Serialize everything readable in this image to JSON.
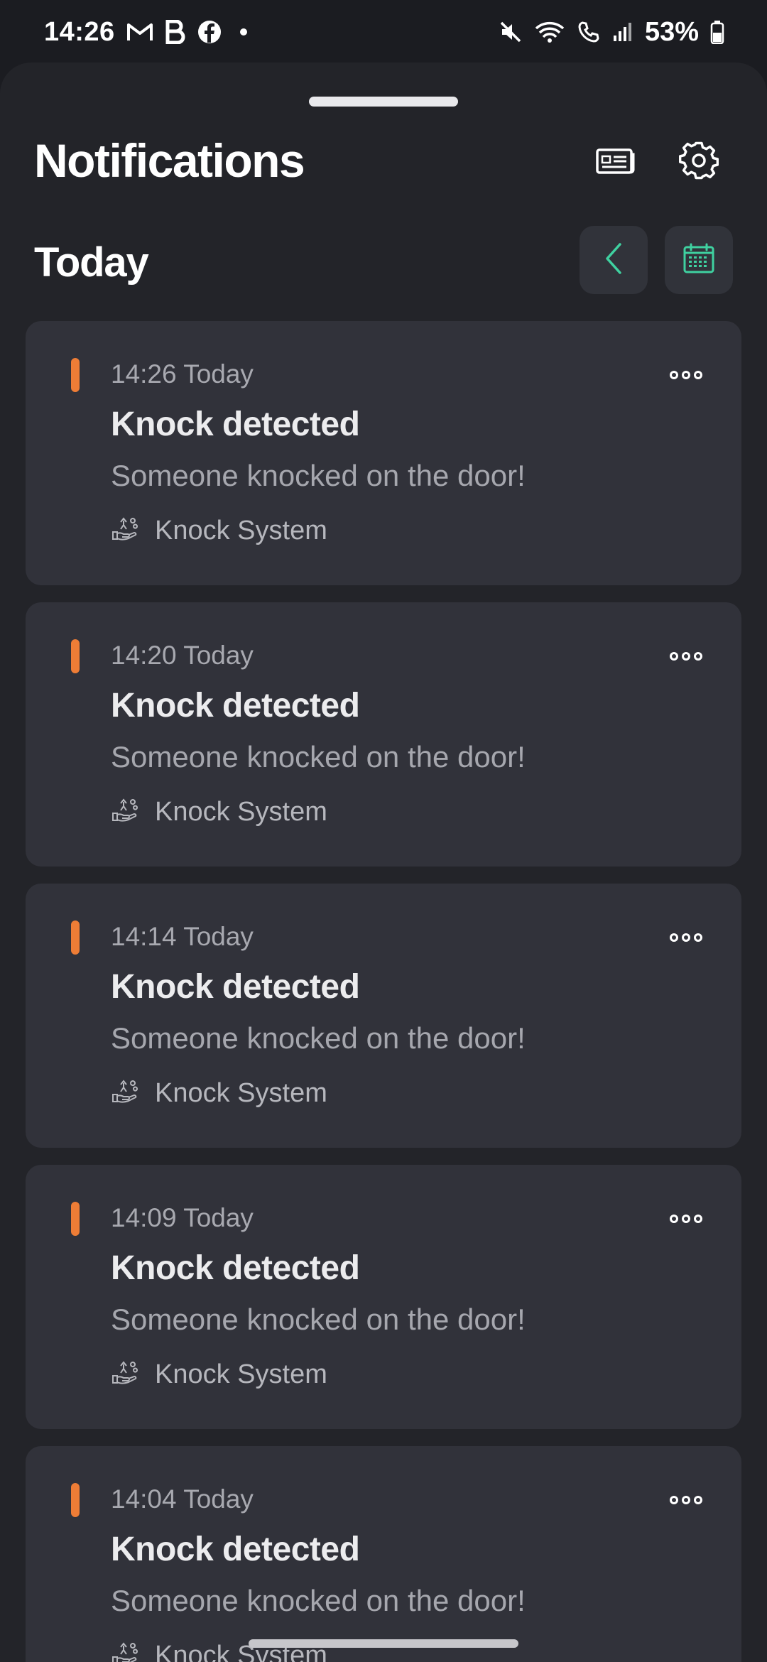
{
  "status_bar": {
    "time": "14:26",
    "app_icons": [
      "gmail-icon",
      "bold-b-icon",
      "facebook-icon"
    ],
    "system_icons": [
      "mute-icon",
      "wifi-icon",
      "wifi-call-icon",
      "signal-icon",
      "battery-icon"
    ],
    "battery_text": "53%"
  },
  "header": {
    "title": "Notifications",
    "news_icon": "news-feed-icon",
    "settings_icon": "gear-icon"
  },
  "section": {
    "title": "Today",
    "prev_icon": "chevron-left-icon",
    "calendar_icon": "calendar-icon"
  },
  "colors": {
    "accent_orange": "#ee7d36",
    "accent_green": "#3fd1a0",
    "card_bg": "#31323a",
    "sheet_bg": "#232429"
  },
  "notifications": [
    {
      "time": "14:26 Today",
      "title": "Knock detected",
      "body": "Someone knocked on the door!",
      "source": "Knock System"
    },
    {
      "time": "14:20 Today",
      "title": "Knock detected",
      "body": "Someone knocked on the door!",
      "source": "Knock System"
    },
    {
      "time": "14:14 Today",
      "title": "Knock detected",
      "body": "Someone knocked on the door!",
      "source": "Knock System"
    },
    {
      "time": "14:09 Today",
      "title": "Knock detected",
      "body": "Someone knocked on the door!",
      "source": "Knock System"
    },
    {
      "time": "14:04 Today",
      "title": "Knock detected",
      "body": "Someone knocked on the door!",
      "source": "Knock System"
    }
  ]
}
